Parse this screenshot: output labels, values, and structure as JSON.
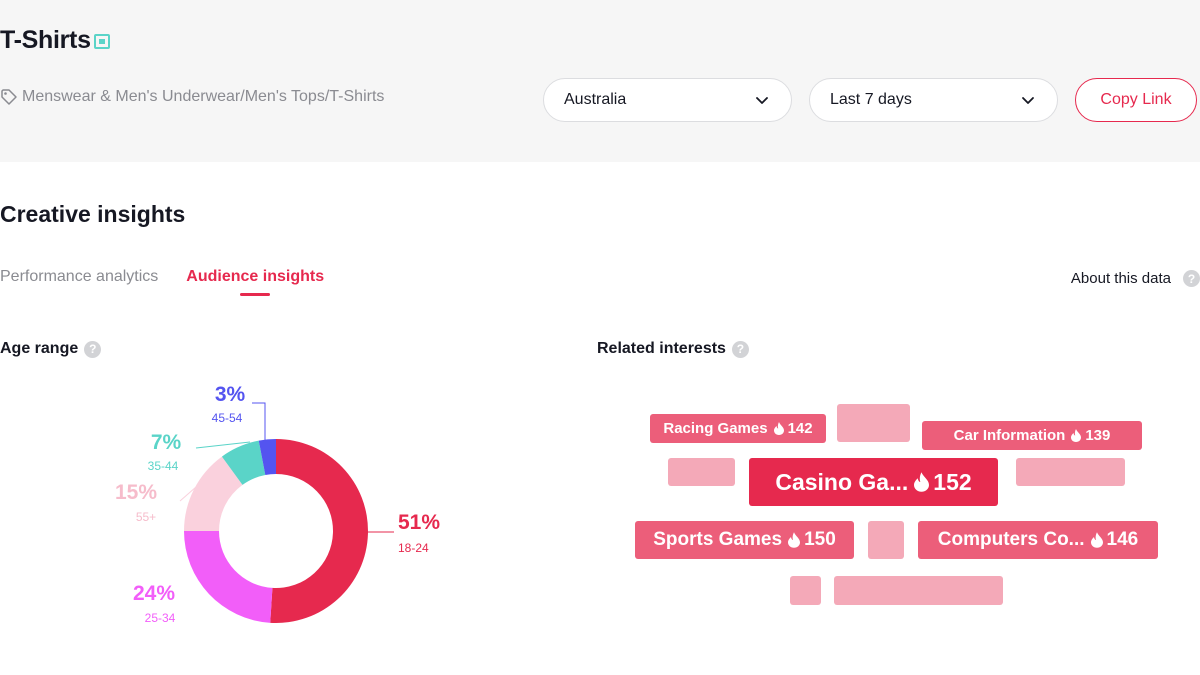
{
  "header": {
    "title": "T-Shirts",
    "breadcrumb": "Menswear & Men's Underwear/Men's Tops/T-Shirts",
    "country_select": "Australia",
    "period_select": "Last 7 days",
    "copy_link": "Copy Link"
  },
  "section": {
    "title": "Creative insights"
  },
  "tabs": [
    {
      "label": "Performance analytics",
      "active": false
    },
    {
      "label": "Audience insights",
      "active": true
    }
  ],
  "about_link": "About this data",
  "age_panel": {
    "label": "Age range"
  },
  "interests_panel": {
    "label": "Related interests",
    "items": [
      {
        "name": "Racing Games",
        "value": "142"
      },
      {
        "name": "Car Information",
        "value": "139"
      },
      {
        "name": "Casino Ga...",
        "value": "152"
      },
      {
        "name": "Sports Games",
        "value": "150"
      },
      {
        "name": "Computers Co...",
        "value": "146"
      }
    ]
  },
  "chart_data": {
    "type": "pie",
    "title": "Age range",
    "slices": [
      {
        "label": "18-24",
        "value": 51,
        "display": "51%",
        "color": "#e6294e"
      },
      {
        "label": "25-34",
        "value": 24,
        "display": "24%",
        "color": "#f25ef9"
      },
      {
        "label": "55+",
        "value": 15,
        "display": "15%",
        "color": "#fad1dd"
      },
      {
        "label": "35-44",
        "value": 7,
        "display": "7%",
        "color": "#5ad4c8"
      },
      {
        "label": "45-54",
        "value": 3,
        "display": "3%",
        "color": "#5454f0"
      }
    ]
  },
  "colors": {
    "accent": "#e6294e",
    "header_bg": "#f6f6f6"
  }
}
